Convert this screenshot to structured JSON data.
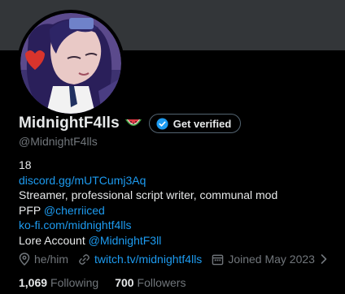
{
  "profile": {
    "display_name": "MidnightF4lls",
    "handle": "@MidnightF4lls",
    "verify_label": "Get verified"
  },
  "bio": {
    "line1": "18",
    "discord": "discord.gg/mUTCumj3Aq",
    "line3": "Streamer, professional script writer, communal mod",
    "pfp_prefix": "PFP ",
    "pfp_link": "@cherriiced",
    "kofi": "ko-fi.com/midnightf4lls",
    "lore_prefix": "Lore Account ",
    "lore_link": "@MidnightF3ll"
  },
  "meta": {
    "pronouns": "he/him",
    "website": "twitch.tv/midnightf4lls",
    "joined": "Joined May 2023"
  },
  "stats": {
    "following_count": "1,069",
    "following_label": "Following",
    "followers_count": "700",
    "followers_label": "Followers"
  },
  "colors": {
    "background": "#000000",
    "banner": "#333639",
    "link": "#1d9bf0",
    "secondary_text": "#71767b",
    "primary_text": "#e7e9ea"
  },
  "icons": [
    "watermelon-emoji-icon",
    "verified-badge-icon",
    "location-pin-icon",
    "link-icon",
    "calendar-icon",
    "chevron-right-icon"
  ]
}
